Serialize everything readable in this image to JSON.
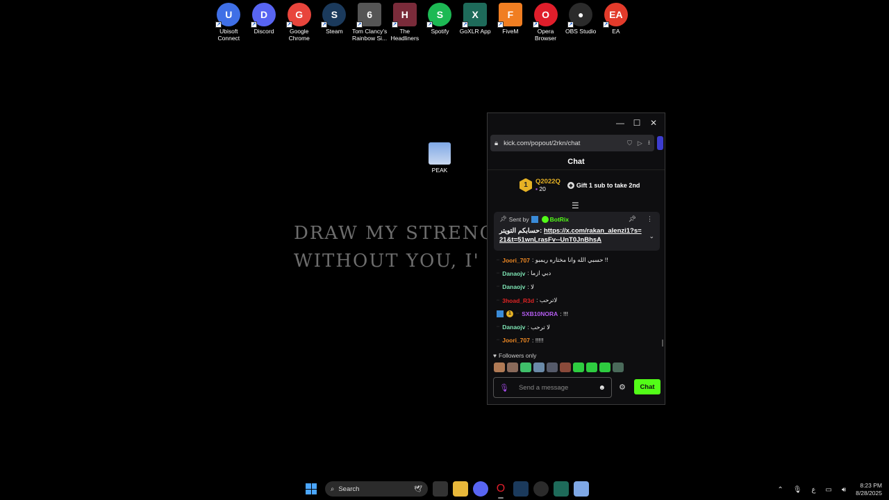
{
  "desktop": {
    "icons": [
      {
        "label": "Ubisoft\nConnect",
        "color": "#3f6fe6",
        "glyph": "U"
      },
      {
        "label": "Discord",
        "color": "#5865f2",
        "glyph": "D"
      },
      {
        "label": "Google\nChrome",
        "color": "#e8453c",
        "glyph": "G"
      },
      {
        "label": "Steam",
        "color": "#1b3a5c",
        "glyph": "S"
      },
      {
        "label": "Tom Clancy's\nRainbow Si...",
        "color": "#555555",
        "glyph": "6"
      },
      {
        "label": "The\nHeadliners",
        "color": "#7a2b3a",
        "glyph": "H"
      },
      {
        "label": "Spotify",
        "color": "#1db954",
        "glyph": "S"
      },
      {
        "label": "GoXLR App",
        "color": "#1e6b5a",
        "glyph": "X"
      },
      {
        "label": "FiveM",
        "color": "#f07e22",
        "glyph": "F"
      },
      {
        "label": "Opera\nBrowser",
        "color": "#e01e2b",
        "glyph": "O"
      },
      {
        "label": "OBS Studio",
        "color": "#2b2b2b",
        "glyph": "●"
      },
      {
        "label": "EA",
        "color": "#e23b2b",
        "glyph": "EA"
      }
    ],
    "peak_label": "PEAK",
    "wallpaper_line1": "DRAW MY STRENGT",
    "wallpaper_line2": "WITHOUT YOU, I'"
  },
  "browser": {
    "url": "kick.com/popout/2rkn/chat",
    "chat_title": "Chat",
    "leaderboard": {
      "rank": "1",
      "user": "Q2022Q",
      "count": "20",
      "gift_text": "Gift 1 sub to take 2nd"
    },
    "pinned": {
      "sent_by": "Sent by",
      "bot_name": "BotRix",
      "prefix": "حسابكم التويتر:",
      "link": "https://x.com/rakan_alenzi1?s=21&t=51wnLrasFv--UnT0JnBhsA"
    },
    "messages": [
      {
        "user": "Joori_707",
        "color": "#f08a24",
        "text": ": حسبي الله وانا مختاره ريمبو !!"
      },
      {
        "user": "Danaojv",
        "color": "#7ee6b5",
        "text": ": دبي ازما"
      },
      {
        "user": "Danaojv",
        "color": "#7ee6b5",
        "text": ": لا"
      },
      {
        "user": "3hoad_R3d",
        "color": "#e02424",
        "text": ": لاترحب"
      },
      {
        "user": "SXB10NORA",
        "color": "#b45cf0",
        "text": ": !!!",
        "rank": "1"
      },
      {
        "user": "Danaojv",
        "color": "#7ee6b5",
        "text": ": لا ترحب"
      },
      {
        "user": "Joori_707",
        "color": "#f08a24",
        "text": ": !!!!!"
      }
    ],
    "followers_only": "Followers only",
    "emote_colors": [
      "#b07a55",
      "#8a6a5a",
      "#3fbf6a",
      "#6a8aa8",
      "#555a6a",
      "#8a4a3a",
      "#2ecc40",
      "#2ecc40",
      "#2ecc40",
      "#4a6a5a"
    ],
    "input_placeholder": "Send a message",
    "send_label": "Chat"
  },
  "taskbar": {
    "search_label": "Search",
    "time": "8:23 PM",
    "date": "8/28/2025",
    "lang": "ع"
  }
}
